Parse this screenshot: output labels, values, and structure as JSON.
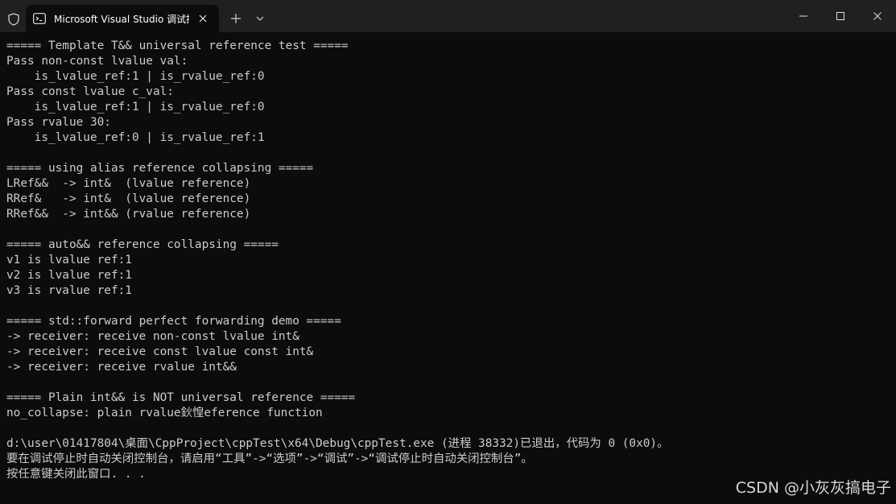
{
  "window": {
    "tab_title": "Microsoft Visual Studio 调试控",
    "icons": {
      "shield": "shield-icon",
      "terminal": "terminal-app-icon",
      "tab_close": "close-icon",
      "new_tab": "plus-icon",
      "dropdown": "chevron-down-icon",
      "minimize": "minimize-icon",
      "maximize": "maximize-icon",
      "close": "close-icon"
    }
  },
  "terminal": {
    "lines": [
      "===== Template T&& universal reference test =====",
      "Pass non-const lvalue val:",
      "    is_lvalue_ref:1 | is_rvalue_ref:0",
      "Pass const lvalue c_val:",
      "    is_lvalue_ref:1 | is_rvalue_ref:0",
      "Pass rvalue 30:",
      "    is_lvalue_ref:0 | is_rvalue_ref:1",
      "",
      "===== using alias reference collapsing =====",
      "LRef&&  -> int&  (lvalue reference)",
      "RRef&   -> int&  (lvalue reference)",
      "RRef&&  -> int&& (rvalue reference)",
      "",
      "===== auto&& reference collapsing =====",
      "v1 is lvalue ref:1",
      "v2 is lvalue ref:1",
      "v3 is rvalue ref:1",
      "",
      "===== std::forward perfect forwarding demo =====",
      "-> receiver: receive non-const lvalue int&",
      "-> receiver: receive const lvalue const int&",
      "-> receiver: receive rvalue int&&",
      "",
      "===== Plain int&& is NOT universal reference =====",
      "no_collapse: plain rvalue鈥惶eference function",
      "",
      "d:\\user\\01417804\\桌面\\CppProject\\cppTest\\x64\\Debug\\cppTest.exe (进程 38332)已退出，代码为 0 (0x0)。",
      "要在调试停止时自动关闭控制台，请启用“工具”->“选项”->“调试”->“调试停止时自动关闭控制台”。",
      "按任意键关闭此窗口. . ."
    ]
  },
  "watermark": "CSDN @小灰灰搞电子"
}
